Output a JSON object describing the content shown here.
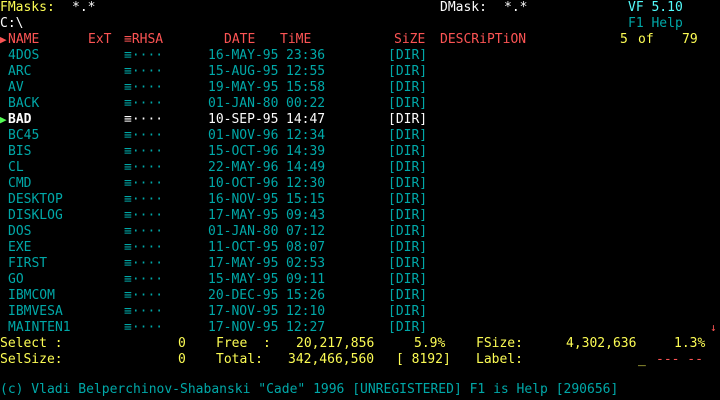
{
  "colors": {
    "background": "#000000",
    "yellow": "#fcfc54",
    "cyan": "#00a8a8",
    "light_cyan": "#54fcfc",
    "red": "#fc5454",
    "white": "#fcfcfc",
    "gray": "#a8a8a8",
    "arrow": "#54fc54"
  },
  "header": {
    "fmasks_label": "FMasks:",
    "fmasks_value": "*.*",
    "dmask_label": "DMask:",
    "dmask_value": "*.*",
    "app_version": "VF 5.10",
    "help_hint": "F1 Help",
    "path": "C:\\",
    "position_current": "5",
    "position_of": "of",
    "position_total": "79"
  },
  "columns": {
    "name": "NAME",
    "ext": "ExT",
    "attr": "≡RHSA",
    "date": "DATE",
    "time": "TiME",
    "size": "SiZE",
    "description": "DESCRiPTiON"
  },
  "files": [
    {
      "name": "4DOS",
      "attr": "≡····",
      "date": "16-MAY-95",
      "time": "23:36",
      "size": "[DIR]"
    },
    {
      "name": "ARC",
      "attr": "≡····",
      "date": "15-AUG-95",
      "time": "12:55",
      "size": "[DIR]"
    },
    {
      "name": "AV",
      "attr": "≡····",
      "date": "19-MAY-95",
      "time": "15:58",
      "size": "[DIR]"
    },
    {
      "name": "BACK",
      "attr": "≡····",
      "date": "01-JAN-80",
      "time": "00:22",
      "size": "[DIR]"
    },
    {
      "name": "BAD",
      "attr": "≡····",
      "date": "10-SEP-95",
      "time": "14:47",
      "size": "[DIR]",
      "selected": true
    },
    {
      "name": "BC45",
      "attr": "≡····",
      "date": "01-NOV-96",
      "time": "12:34",
      "size": "[DIR]"
    },
    {
      "name": "BIS",
      "attr": "≡····",
      "date": "15-OCT-96",
      "time": "14:39",
      "size": "[DIR]"
    },
    {
      "name": "CL",
      "attr": "≡····",
      "date": "22-MAY-96",
      "time": "14:49",
      "size": "[DIR]"
    },
    {
      "name": "CMD",
      "attr": "≡····",
      "date": "10-OCT-96",
      "time": "12:30",
      "size": "[DIR]"
    },
    {
      "name": "DESKTOP",
      "attr": "≡····",
      "date": "16-NOV-95",
      "time": "15:15",
      "size": "[DIR]"
    },
    {
      "name": "DISKLOG",
      "attr": "≡····",
      "date": "17-MAY-95",
      "time": "09:43",
      "size": "[DIR]"
    },
    {
      "name": "DOS",
      "attr": "≡····",
      "date": "01-JAN-80",
      "time": "07:12",
      "size": "[DIR]"
    },
    {
      "name": "EXE",
      "attr": "≡····",
      "date": "11-OCT-95",
      "time": "08:07",
      "size": "[DIR]"
    },
    {
      "name": "FIRST",
      "attr": "≡····",
      "date": "17-MAY-95",
      "time": "02:53",
      "size": "[DIR]"
    },
    {
      "name": "GO",
      "attr": "≡····",
      "date": "15-MAY-95",
      "time": "09:11",
      "size": "[DIR]"
    },
    {
      "name": "IBMCOM",
      "attr": "≡····",
      "date": "20-DEC-95",
      "time": "15:26",
      "size": "[DIR]"
    },
    {
      "name": "IBMVESA",
      "attr": "≡····",
      "date": "17-NOV-95",
      "time": "12:10",
      "size": "[DIR]"
    },
    {
      "name": "MAINTEN1",
      "attr": "≡····",
      "date": "17-NOV-95",
      "time": "12:27",
      "size": "[DIR]"
    }
  ],
  "stats": {
    "select_label": "Select :",
    "select_value": "0",
    "free_label": "Free  :",
    "free_value": "20,217,856",
    "free_percent": "5.9%",
    "fsize_label": "FSize:",
    "fsize_value": "4,302,636",
    "fsize_percent": "1.3%",
    "selsize_label": "SelSize:",
    "selsize_value": "0",
    "total_label": "Total:",
    "total_value": "342,466,560",
    "cluster": "[ 8192]",
    "label_label": "Label:",
    "label_value": "_",
    "label_dashes": "--- --"
  },
  "footer": {
    "text": "(c) Vladi Belperchinov-Shabanski \"Cade\" 1996 [UNREGISTERED] F1 is Help [290656]"
  }
}
